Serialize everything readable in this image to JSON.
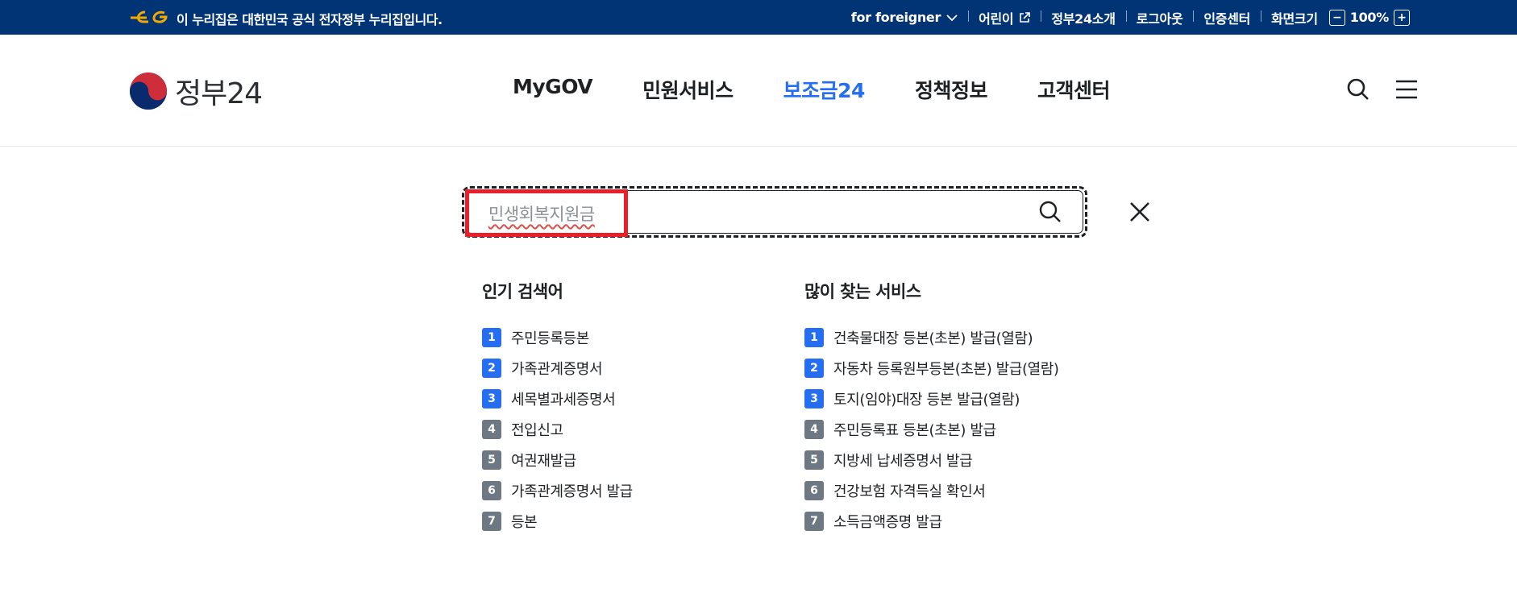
{
  "govbar": {
    "notice": "이 누리집은 대한민국 공식 전자정부 누리집입니다.",
    "foreigner": "for foreigner",
    "kids": "어린이",
    "intro": "정부24소개",
    "logout": "로그아웃",
    "cert_center": "인증센터",
    "screen_size": "화면크기",
    "zoom_out": "−",
    "zoom_value": "100%",
    "zoom_in": "+"
  },
  "header": {
    "brand": "정부24",
    "nav": [
      "MyGOV",
      "민원서비스",
      "보조금24",
      "정책정보",
      "고객센터"
    ],
    "active_nav": "보조금24",
    "accent_color": "#256ef4"
  },
  "search": {
    "value": "민생회복지원금",
    "icons": [
      "search-icon",
      "close-icon"
    ]
  },
  "popular": {
    "title": "인기 검색어",
    "items": [
      {
        "rank": "1",
        "label": "주민등록등본"
      },
      {
        "rank": "2",
        "label": "가족관계증명서"
      },
      {
        "rank": "3",
        "label": "세목별과세증명서"
      },
      {
        "rank": "4",
        "label": "전입신고"
      },
      {
        "rank": "5",
        "label": "여권재발급"
      },
      {
        "rank": "6",
        "label": "가족관계증명서 발급"
      },
      {
        "rank": "7",
        "label": "등본"
      }
    ]
  },
  "services": {
    "title": "많이 찾는 서비스",
    "items": [
      {
        "rank": "1",
        "label": "건축물대장 등본(초본) 발급(열람)"
      },
      {
        "rank": "2",
        "label": "자동차 등록원부등본(초본) 발급(열람)"
      },
      {
        "rank": "3",
        "label": "토지(임야)대장 등본 발급(열람)"
      },
      {
        "rank": "4",
        "label": "주민등록표 등본(초본) 발급"
      },
      {
        "rank": "5",
        "label": "지방세 납세증명서 발급"
      },
      {
        "rank": "6",
        "label": "건강보험 자격득실 확인서"
      },
      {
        "rank": "7",
        "label": "소득금액증명 발급"
      }
    ]
  }
}
